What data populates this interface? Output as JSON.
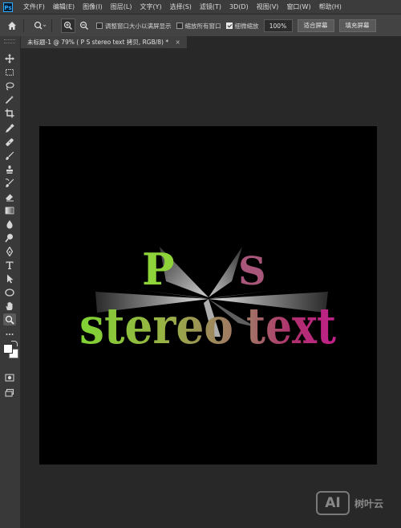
{
  "app": {
    "logo": "Ps"
  },
  "menu": [
    "文件(F)",
    "编辑(E)",
    "图像(I)",
    "图层(L)",
    "文字(Y)",
    "选择(S)",
    "滤镜(T)",
    "3D(D)",
    "视图(V)",
    "窗口(W)",
    "帮助(H)"
  ],
  "options": {
    "resize_windows": {
      "label": "调整窗口大小以满屏显示",
      "checked": false
    },
    "zoom_all": {
      "label": "缩放所有窗口",
      "checked": false
    },
    "scrubby_zoom": {
      "label": "细微缩放",
      "checked": true
    },
    "zoom_value": "100%",
    "fit_screen": "适合屏幕",
    "fill_screen": "填充屏幕"
  },
  "document_tab": "未标题-1 @ 79% (    P     S      stereo text 拷贝, RGB/8) *",
  "artwork": {
    "top_letters": [
      "P",
      "S"
    ],
    "word_left": "stereo",
    "word_right": "text",
    "colors": {
      "green": "#7fd334",
      "pink": "#b0306e",
      "mid": "#a07864",
      "canvas": "#000000"
    }
  },
  "watermark": {
    "logo": "AI",
    "text": "树叶云"
  },
  "tools": [
    "move-icon",
    "marquee-icon",
    "lasso-icon",
    "magic-wand-icon",
    "crop-icon",
    "eyedropper-icon",
    "healing-icon",
    "brush-icon",
    "stamp-icon",
    "history-brush-icon",
    "eraser-icon",
    "gradient-icon",
    "blur-icon",
    "dodge-icon",
    "pen-icon",
    "type-icon",
    "path-select-icon",
    "ellipse-icon",
    "hand-icon",
    "zoom-tool-icon",
    "more-tools-icon",
    "color-swatches",
    "quick-mask-icon",
    "screen-mode-icon"
  ]
}
